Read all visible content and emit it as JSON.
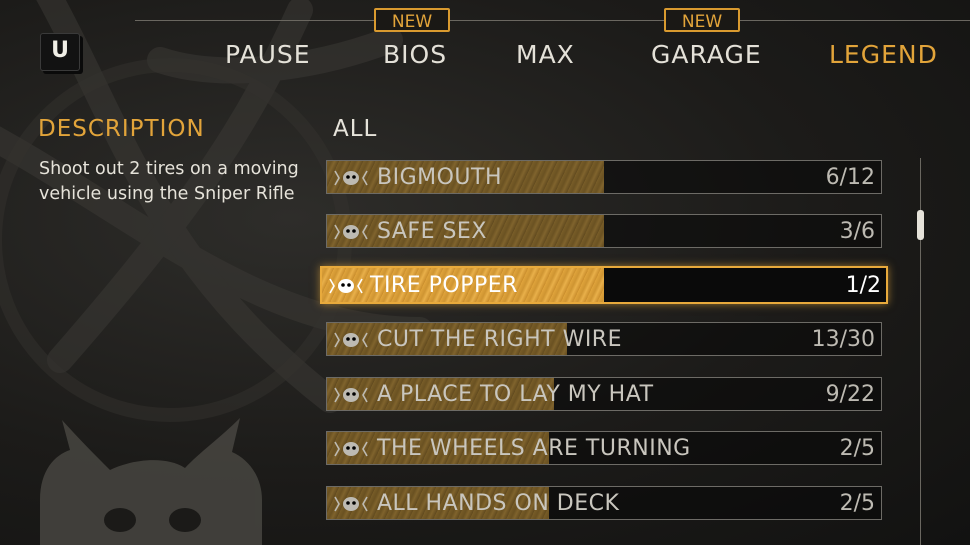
{
  "header": {
    "key_hint": "U",
    "tabs": [
      {
        "label": "PAUSE",
        "badge": null,
        "active": false
      },
      {
        "label": "BIOS",
        "badge": "NEW",
        "active": false
      },
      {
        "label": "MAX",
        "badge": null,
        "active": false
      },
      {
        "label": "GARAGE",
        "badge": "NEW",
        "active": false
      },
      {
        "label": "LEGEND",
        "badge": null,
        "active": true
      }
    ]
  },
  "description": {
    "title": "DESCRIPTION",
    "text": "Shoot out 2 tires on a moving vehicle using the Sniper Rifle"
  },
  "list": {
    "filter_label": "ALL",
    "items": [
      {
        "name": "BIGMOUTH",
        "count": "6/12",
        "progress": 0.5,
        "selected": false
      },
      {
        "name": "SAFE SEX",
        "count": "3/6",
        "progress": 0.5,
        "selected": false
      },
      {
        "name": "TIRE POPPER",
        "count": "1/2",
        "progress": 0.5,
        "selected": true
      },
      {
        "name": "CUT THE RIGHT WIRE",
        "count": "13/30",
        "progress": 0.433,
        "selected": false
      },
      {
        "name": "A PLACE TO LAY MY HAT",
        "count": "9/22",
        "progress": 0.409,
        "selected": false
      },
      {
        "name": "THE WHEELS ARE TURNING",
        "count": "2/5",
        "progress": 0.4,
        "selected": false
      },
      {
        "name": "ALL HANDS ON DECK",
        "count": "2/5",
        "progress": 0.4,
        "selected": false
      }
    ]
  },
  "colors": {
    "accent": "#e2a43a",
    "text": "#e4e1d8",
    "background": "#1c1b19"
  },
  "icons": {
    "row_icon": "skull-wings-icon",
    "background_emblem": "skull-emblem-icon"
  }
}
